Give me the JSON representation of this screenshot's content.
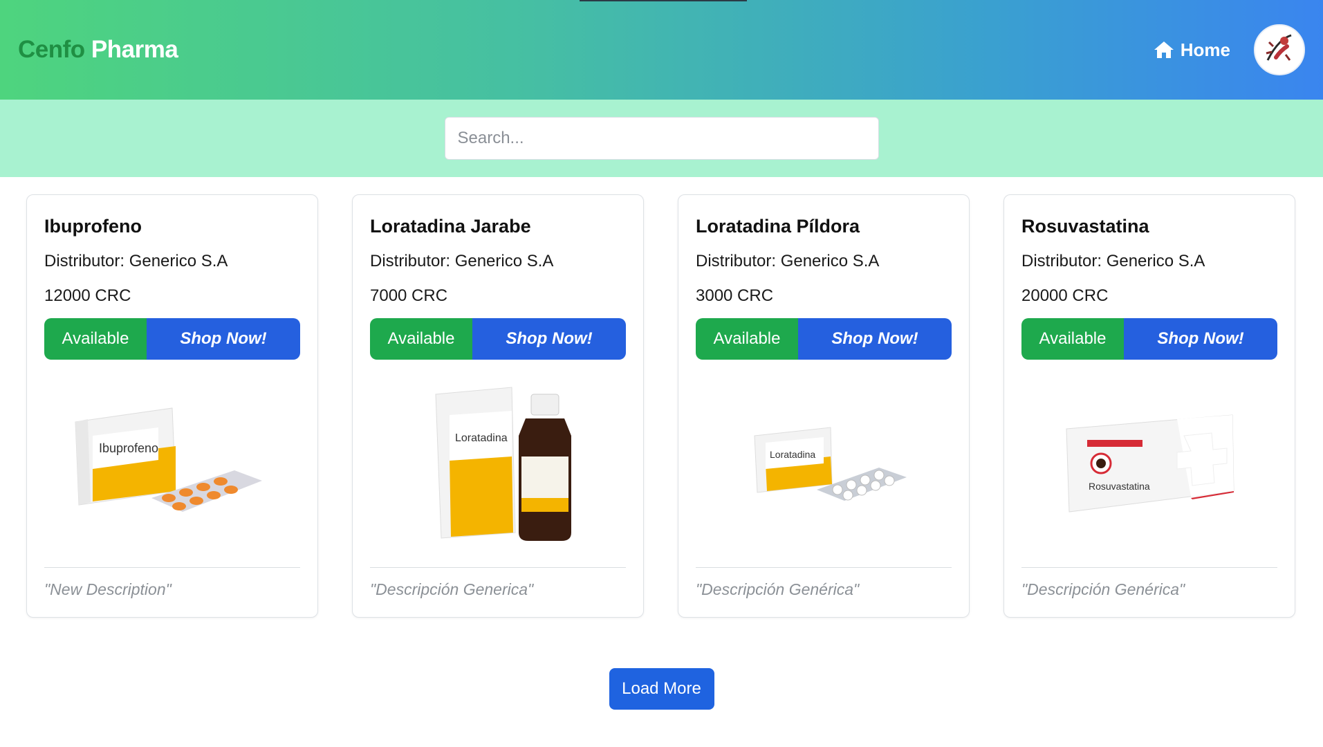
{
  "header": {
    "brand_part1": "Cenfo",
    "brand_part2": "Pharma",
    "home_label": "Home",
    "home_icon": "home-icon",
    "avatar_icon": "user-avatar"
  },
  "search": {
    "placeholder": "Search..."
  },
  "colors": {
    "brand_green": "#1f8f43",
    "available_green": "#1ea94d",
    "shop_blue": "#2560df",
    "search_band": "#a8f2d0",
    "load_more_blue": "#1f63e0"
  },
  "products": [
    {
      "name": "Ibuprofeno",
      "distributor": "Distributor: Generico S.A",
      "price": "12000 CRC",
      "status": "Available",
      "shop_label": "Shop Now!",
      "description": "\"New Description\"",
      "image_icon": "medicine-box-tablets"
    },
    {
      "name": "Loratadina Jarabe",
      "distributor": "Distributor: Generico S.A",
      "price": "7000 CRC",
      "status": "Available",
      "shop_label": "Shop Now!",
      "description": "\"Descripción Generica\"",
      "image_icon": "medicine-box-syrup"
    },
    {
      "name": "Loratadina Píldora",
      "distributor": "Distributor: Generico S.A",
      "price": "3000 CRC",
      "status": "Available",
      "shop_label": "Shop Now!",
      "description": "\"Descripción Genérica\"",
      "image_icon": "medicine-box-pills"
    },
    {
      "name": "Rosuvastatina",
      "distributor": "Distributor: Generico S.A",
      "price": "20000 CRC",
      "status": "Available",
      "shop_label": "Shop Now!",
      "description": "\"Descripción Genérica\"",
      "image_icon": "medicine-box-red"
    }
  ],
  "load_more_label": "Load More"
}
